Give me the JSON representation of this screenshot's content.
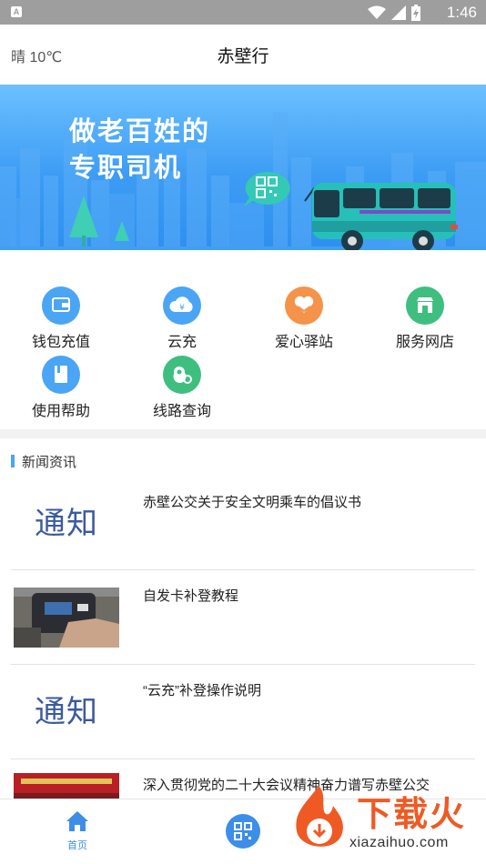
{
  "status_bar": {
    "time": "1:46",
    "left_badge": "A",
    "background": "#9e9e9e",
    "icons": [
      "wifi-icon",
      "cell-signal-icon",
      "battery-charging-icon"
    ]
  },
  "header": {
    "weather": "晴 10℃",
    "title": "赤壁行"
  },
  "banner": {
    "slogan_line1": "做老百姓的",
    "slogan_line2": "专职司机",
    "colors": {
      "sky": "#3c9cf4",
      "bus": "#26c0b8"
    }
  },
  "menu": [
    {
      "label": "钱包充值",
      "icon": "wallet-icon",
      "color": "#4aa5f5"
    },
    {
      "label": "云充",
      "icon": "cloud-yen-icon",
      "color": "#4aa5f5"
    },
    {
      "label": "爱心驿站",
      "icon": "heart-hands-icon",
      "color": "#f5934a"
    },
    {
      "label": "服务网店",
      "icon": "store-icon",
      "color": "#3fbf7f"
    },
    {
      "label": "使用帮助",
      "icon": "help-book-icon",
      "color": "#4aa5f5"
    },
    {
      "label": "线路查询",
      "icon": "route-pin-icon",
      "color": "#3fbf7f"
    }
  ],
  "news": {
    "section_title": "新闻资讯",
    "items": [
      {
        "title": "赤壁公交关于安全文明乘车的倡议书",
        "thumb_text": "通知"
      },
      {
        "title": "自发卡补登教程",
        "thumb_text": ""
      },
      {
        "title": "“云充”补登操作说明",
        "thumb_text": "通知"
      },
      {
        "title": "深入贯彻党的二十大会议精神奋力谱写赤壁公交",
        "thumb_text": ""
      }
    ]
  },
  "bottom_nav": {
    "home_label": "首页",
    "accent": "#3d8ee8"
  },
  "watermark": {
    "text": "下载火",
    "sub": "xiazaihuo.com"
  }
}
